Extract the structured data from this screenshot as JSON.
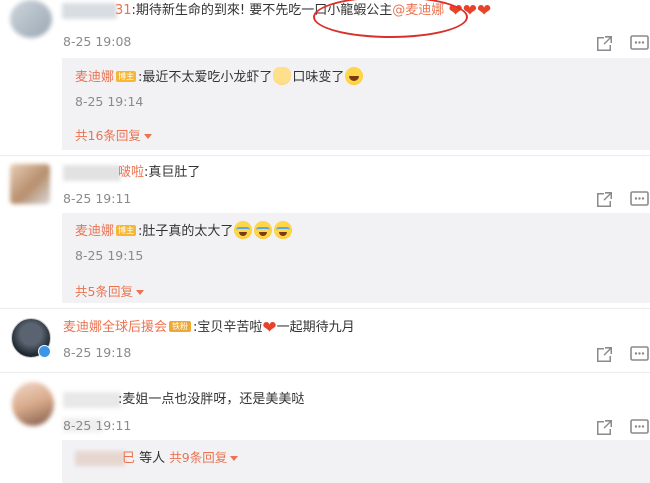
{
  "comments": [
    {
      "username_suffix": "31",
      "text": ":期待新生命的到來! 要不先吃一口小龍蝦公主",
      "mention": "@麦迪娜",
      "date": "8-25 19:08",
      "reply": {
        "name": "麦迪娜",
        "badge": "博主",
        "text_a": ":最近不太爱吃小龙虾了",
        "text_b": "口味变了",
        "date": "8-25 19:14",
        "more": "共16条回复"
      }
    },
    {
      "username_suffix": "啵啦",
      "text": ":真巨肚了",
      "date": "8-25 19:11",
      "reply": {
        "name": "麦迪娜",
        "badge": "博主",
        "text_a": ":肚子真的太大了",
        "date": "8-25 19:15",
        "more": "共5条回复"
      }
    },
    {
      "username": "麦迪娜全球后援会",
      "badge": "铁粉",
      "text_a": ":宝贝辛苦啦",
      "text_b": "一起期待九月",
      "date": "8-25 19:18"
    },
    {
      "text": ":麦姐一点也没胖呀，还是美美哒",
      "date": "8-25 19:11",
      "reply_summary": {
        "name_suffix": "巳",
        "middle": " 等人 ",
        "more": "共9条回复"
      }
    }
  ],
  "icons": {
    "share": "share-icon",
    "comment": "comment-icon",
    "heart": "heart-icon",
    "caret": "caret-down-icon"
  },
  "colors": {
    "name": "#eb7350",
    "date": "#8a8a8a",
    "reply_bg": "#f2f2f5",
    "highlight": "#d9302b"
  }
}
